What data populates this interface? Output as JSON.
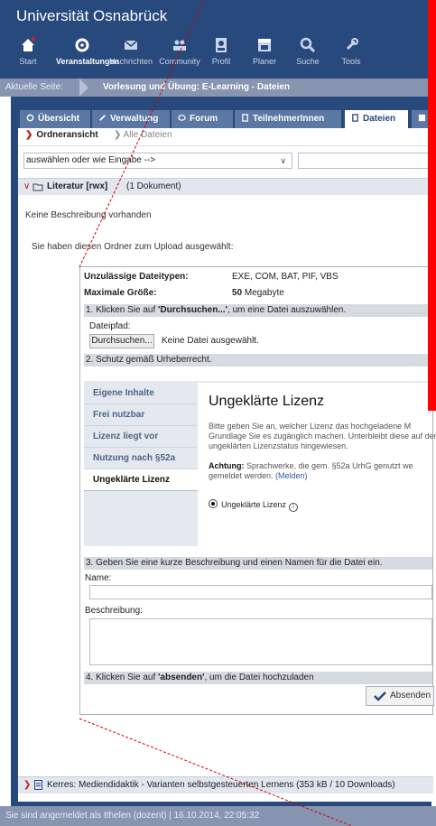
{
  "header": {
    "title": "Universität Osnabrück",
    "nav": [
      {
        "label": "Start",
        "icon": "home-icon"
      },
      {
        "label": "Veranstaltungen",
        "icon": "courses-icon",
        "active": true
      },
      {
        "label": "Nachrichten",
        "icon": "mail-icon"
      },
      {
        "label": "Community",
        "icon": "community-icon"
      },
      {
        "label": "Profil",
        "icon": "profile-icon"
      },
      {
        "label": "Planer",
        "icon": "calendar-icon"
      },
      {
        "label": "Suche",
        "icon": "search-icon"
      },
      {
        "label": "Tools",
        "icon": "wrench-icon"
      }
    ]
  },
  "crumb": {
    "label": "Aktuelle Seite:",
    "title": "Vorlesung und Übung: E-Learning - Dateien"
  },
  "tabs": [
    {
      "label": "Übersicht"
    },
    {
      "label": "Verwaltung"
    },
    {
      "label": "Forum"
    },
    {
      "label": "TeilnehmerInnen"
    },
    {
      "label": "Dateien",
      "active": true
    }
  ],
  "subnav": {
    "selected": "Ordneransicht",
    "alt": "Alle Dateien"
  },
  "select": {
    "value": "auswählen oder wie Eingabe -->"
  },
  "folder": {
    "name": "Literatur [rwx]",
    "count": "(1 Dokument)",
    "description": "Keine Beschreibung vorhanden",
    "upload_note": "Sie haben diesen Ordner zum Upload ausgewählt:"
  },
  "upload": {
    "forbidden_label": "Unzulässige Dateitypen:",
    "forbidden_value": "EXE, COM, BAT, PIF, VBS",
    "maxsize_label": "Maximale Größe:",
    "maxsize_value": "50",
    "maxsize_unit": "Megabyte",
    "step1_pre": "1. Klicken Sie auf ",
    "step1_bold": "'Durchsuchen...'",
    "step1_post": ", um eine Datei auszuwählen.",
    "filepath_label": "Dateipfad:",
    "browse_button": "Durchsuchen...",
    "nofile": "Keine Datei ausgewählt.",
    "step2": "2. Schutz gemäß Urheberrecht.",
    "step3": "3. Geben Sie eine kurze Beschreibung und einen Namen für die Datei ein.",
    "name_label": "Name:",
    "desc_label": "Beschreibung:",
    "step4_pre": "4. Klicken Sie auf ",
    "step4_bold": "'absenden'",
    "step4_post": ", um die Datei hochzuladen",
    "submit": "Absenden"
  },
  "license": {
    "options": [
      "Eigene Inhalte",
      "Frei nutzbar",
      "Lizenz liegt vor",
      "Nutzung nach §52a",
      "Ungeklärte Lizenz"
    ],
    "active_index": 4,
    "panel_title": "Ungeklärte Lizenz",
    "panel_text": "Bitte geben Sie an, welcher Lizenz das hochgeladene M Grundlage Sie es zugänglich machen. Unterbleibt diese auf den ungeklärten Lizenzstatus hingewiesen.",
    "warn_bold": "Achtung:",
    "warn_text": " Sprachwerke, die gem. §52a UrhG genutzt we gemeldet werden. ",
    "warn_link": "(Melden)",
    "radio_label": "Ungeklärte Lizenz"
  },
  "file": {
    "name": "Kerres: Mediendidaktik - Varianten selbstgesteuerten Lernens  (353 kB / 10 Downloads)"
  },
  "footer": {
    "text": "Sie sind angemeldet als tthelen (dozent) | 16.10.2014, 22:05:32"
  },
  "colors": {
    "brand": "#28497c",
    "bar": "#8795b0",
    "accent_red": "#c01a1a",
    "marker_red": "#ff0000"
  }
}
